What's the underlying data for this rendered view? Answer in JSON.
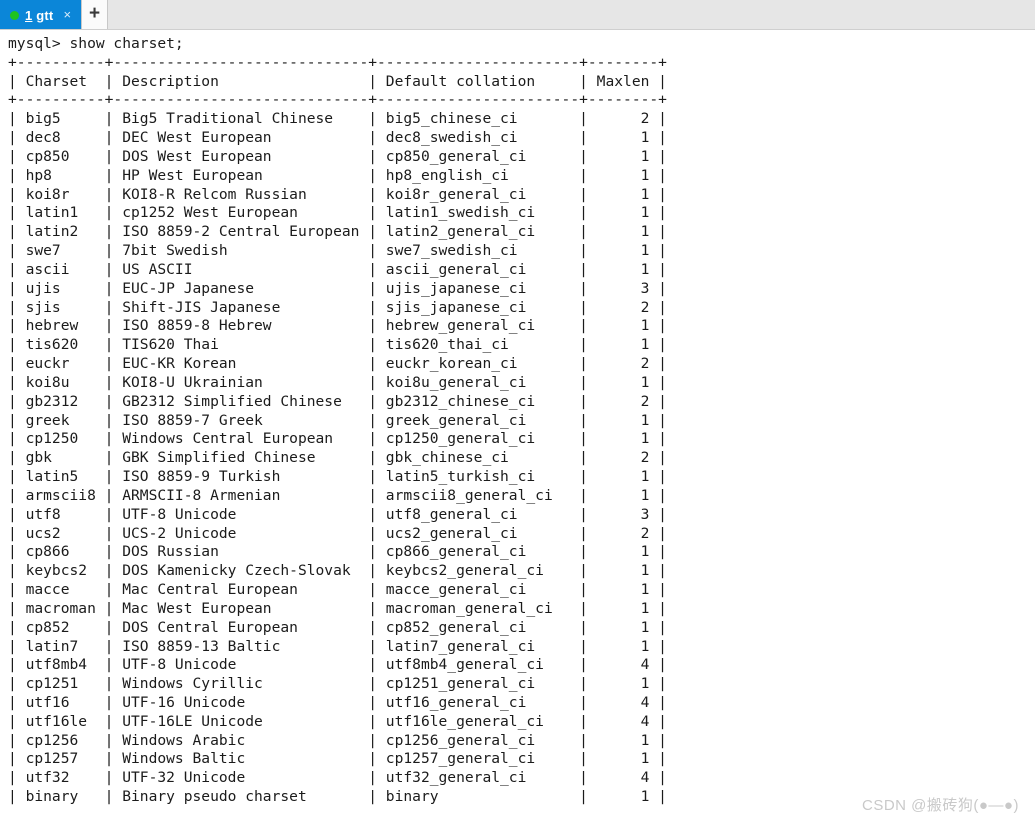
{
  "window": {
    "title": "1 gtt",
    "tabbar_bg": "#e6e6e6",
    "active_tab_bg": "#0b86d8",
    "status_dot_color": "#1fc31f"
  },
  "tabs": [
    {
      "number": "1",
      "name": " gtt",
      "full_label": "1 gtt",
      "close_glyph": "×",
      "active": true
    }
  ],
  "new_tab_button": {
    "glyph": "+"
  },
  "terminal": {
    "prompt": "mysql>",
    "command": "show charset;",
    "prompt_line": "mysql> show charset;",
    "separator": "+----------+-----------------------------+-----------------------+--------+",
    "columns": [
      {
        "header": "Charset",
        "width": 8,
        "align": "left"
      },
      {
        "header": "Description",
        "width": 27,
        "align": "left"
      },
      {
        "header": "Default collation",
        "width": 21,
        "align": "left"
      },
      {
        "header": "Maxlen",
        "width": 6,
        "align": "right"
      }
    ],
    "rows": [
      {
        "charset": "big5",
        "description": "Big5 Traditional Chinese",
        "collation": "big5_chinese_ci",
        "maxlen": "2"
      },
      {
        "charset": "dec8",
        "description": "DEC West European",
        "collation": "dec8_swedish_ci",
        "maxlen": "1"
      },
      {
        "charset": "cp850",
        "description": "DOS West European",
        "collation": "cp850_general_ci",
        "maxlen": "1"
      },
      {
        "charset": "hp8",
        "description": "HP West European",
        "collation": "hp8_english_ci",
        "maxlen": "1"
      },
      {
        "charset": "koi8r",
        "description": "KOI8-R Relcom Russian",
        "collation": "koi8r_general_ci",
        "maxlen": "1"
      },
      {
        "charset": "latin1",
        "description": "cp1252 West European",
        "collation": "latin1_swedish_ci",
        "maxlen": "1"
      },
      {
        "charset": "latin2",
        "description": "ISO 8859-2 Central European",
        "collation": "latin2_general_ci",
        "maxlen": "1"
      },
      {
        "charset": "swe7",
        "description": "7bit Swedish",
        "collation": "swe7_swedish_ci",
        "maxlen": "1"
      },
      {
        "charset": "ascii",
        "description": "US ASCII",
        "collation": "ascii_general_ci",
        "maxlen": "1"
      },
      {
        "charset": "ujis",
        "description": "EUC-JP Japanese",
        "collation": "ujis_japanese_ci",
        "maxlen": "3"
      },
      {
        "charset": "sjis",
        "description": "Shift-JIS Japanese",
        "collation": "sjis_japanese_ci",
        "maxlen": "2"
      },
      {
        "charset": "hebrew",
        "description": "ISO 8859-8 Hebrew",
        "collation": "hebrew_general_ci",
        "maxlen": "1"
      },
      {
        "charset": "tis620",
        "description": "TIS620 Thai",
        "collation": "tis620_thai_ci",
        "maxlen": "1"
      },
      {
        "charset": "euckr",
        "description": "EUC-KR Korean",
        "collation": "euckr_korean_ci",
        "maxlen": "2"
      },
      {
        "charset": "koi8u",
        "description": "KOI8-U Ukrainian",
        "collation": "koi8u_general_ci",
        "maxlen": "1"
      },
      {
        "charset": "gb2312",
        "description": "GB2312 Simplified Chinese",
        "collation": "gb2312_chinese_ci",
        "maxlen": "2"
      },
      {
        "charset": "greek",
        "description": "ISO 8859-7 Greek",
        "collation": "greek_general_ci",
        "maxlen": "1"
      },
      {
        "charset": "cp1250",
        "description": "Windows Central European",
        "collation": "cp1250_general_ci",
        "maxlen": "1"
      },
      {
        "charset": "gbk",
        "description": "GBK Simplified Chinese",
        "collation": "gbk_chinese_ci",
        "maxlen": "2"
      },
      {
        "charset": "latin5",
        "description": "ISO 8859-9 Turkish",
        "collation": "latin5_turkish_ci",
        "maxlen": "1"
      },
      {
        "charset": "armscii8",
        "description": "ARMSCII-8 Armenian",
        "collation": "armscii8_general_ci",
        "maxlen": "1"
      },
      {
        "charset": "utf8",
        "description": "UTF-8 Unicode",
        "collation": "utf8_general_ci",
        "maxlen": "3"
      },
      {
        "charset": "ucs2",
        "description": "UCS-2 Unicode",
        "collation": "ucs2_general_ci",
        "maxlen": "2"
      },
      {
        "charset": "cp866",
        "description": "DOS Russian",
        "collation": "cp866_general_ci",
        "maxlen": "1"
      },
      {
        "charset": "keybcs2",
        "description": "DOS Kamenicky Czech-Slovak",
        "collation": "keybcs2_general_ci",
        "maxlen": "1"
      },
      {
        "charset": "macce",
        "description": "Mac Central European",
        "collation": "macce_general_ci",
        "maxlen": "1"
      },
      {
        "charset": "macroman",
        "description": "Mac West European",
        "collation": "macroman_general_ci",
        "maxlen": "1"
      },
      {
        "charset": "cp852",
        "description": "DOS Central European",
        "collation": "cp852_general_ci",
        "maxlen": "1"
      },
      {
        "charset": "latin7",
        "description": "ISO 8859-13 Baltic",
        "collation": "latin7_general_ci",
        "maxlen": "1"
      },
      {
        "charset": "utf8mb4",
        "description": "UTF-8 Unicode",
        "collation": "utf8mb4_general_ci",
        "maxlen": "4"
      },
      {
        "charset": "cp1251",
        "description": "Windows Cyrillic",
        "collation": "cp1251_general_ci",
        "maxlen": "1"
      },
      {
        "charset": "utf16",
        "description": "UTF-16 Unicode",
        "collation": "utf16_general_ci",
        "maxlen": "4"
      },
      {
        "charset": "utf16le",
        "description": "UTF-16LE Unicode",
        "collation": "utf16le_general_ci",
        "maxlen": "4"
      },
      {
        "charset": "cp1256",
        "description": "Windows Arabic",
        "collation": "cp1256_general_ci",
        "maxlen": "1"
      },
      {
        "charset": "cp1257",
        "description": "Windows Baltic",
        "collation": "cp1257_general_ci",
        "maxlen": "1"
      },
      {
        "charset": "utf32",
        "description": "UTF-32 Unicode",
        "collation": "utf32_general_ci",
        "maxlen": "4"
      },
      {
        "charset": "binary",
        "description": "Binary pseudo charset",
        "collation": "binary",
        "maxlen": "1"
      }
    ]
  },
  "watermark": {
    "text": "CSDN @搬砖狗(●—●)"
  }
}
